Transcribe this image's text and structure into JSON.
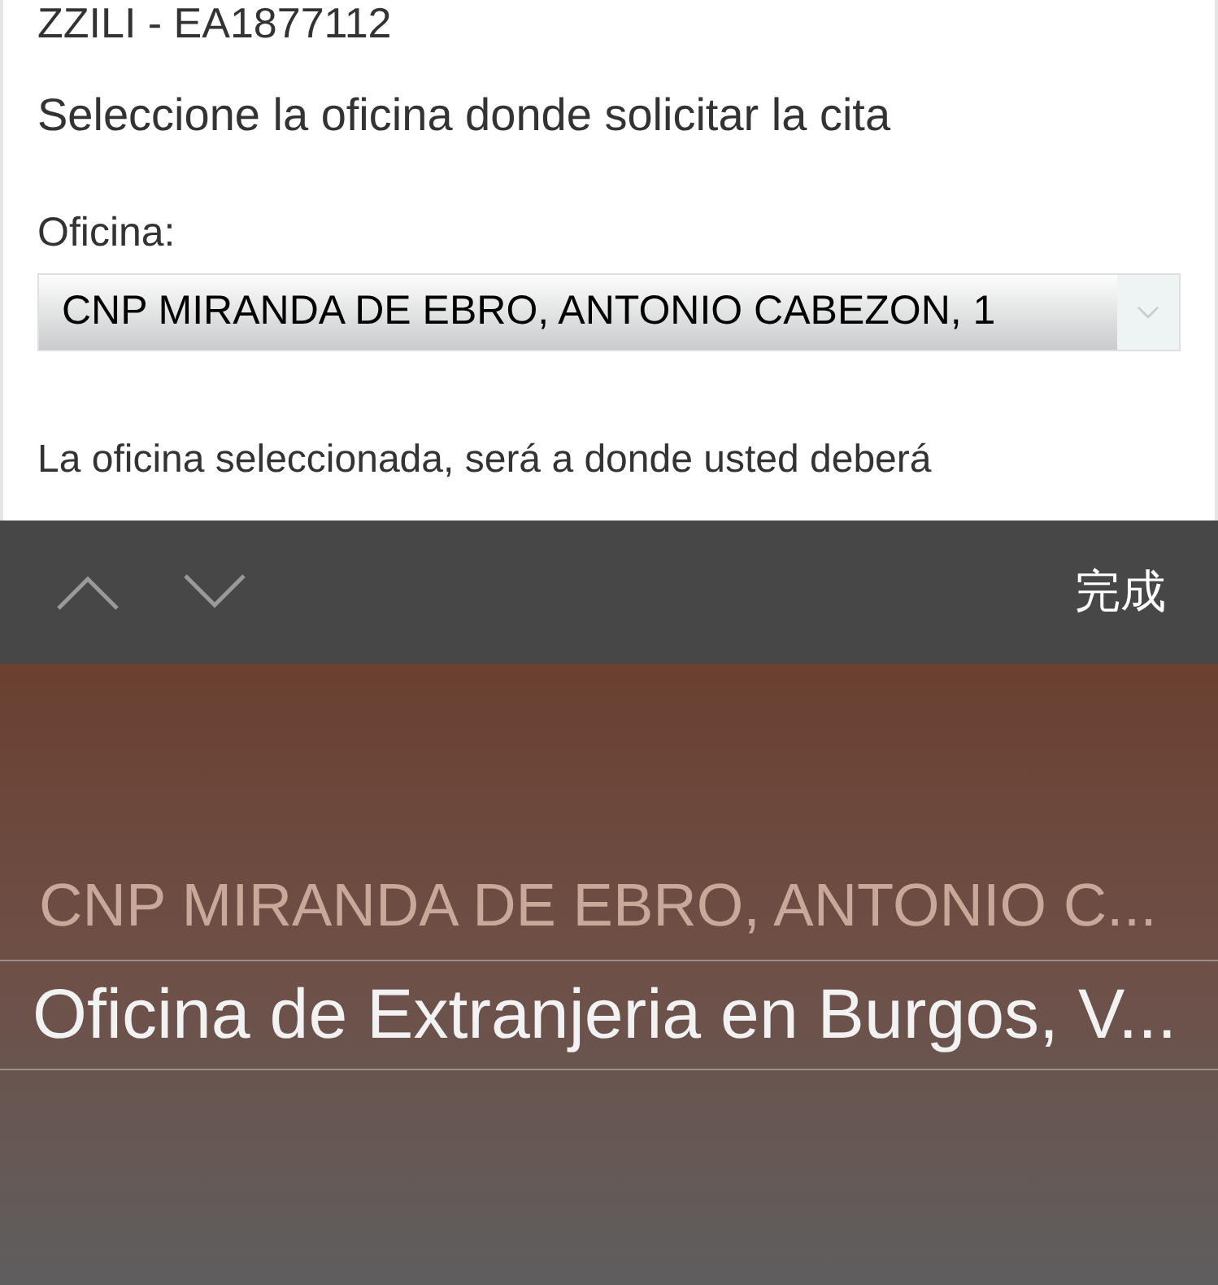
{
  "page": {
    "reference": "ZZILI - EA1877112",
    "heading": "Seleccione la oficina donde solicitar la cita",
    "office_label": "Oficina:",
    "office_select": {
      "value": "CNP MIRANDA DE EBRO, ANTONIO CABEZON, 1"
    },
    "note": "La oficina seleccionada, será a donde usted deberá"
  },
  "toolbar": {
    "done": "完成"
  },
  "picker": {
    "items": [
      {
        "label": "CNP MIRANDA DE EBRO, ANTONIO C...",
        "selected": false
      },
      {
        "label": "Oficina de Extranjeria en Burgos, V...",
        "selected": true
      }
    ]
  }
}
